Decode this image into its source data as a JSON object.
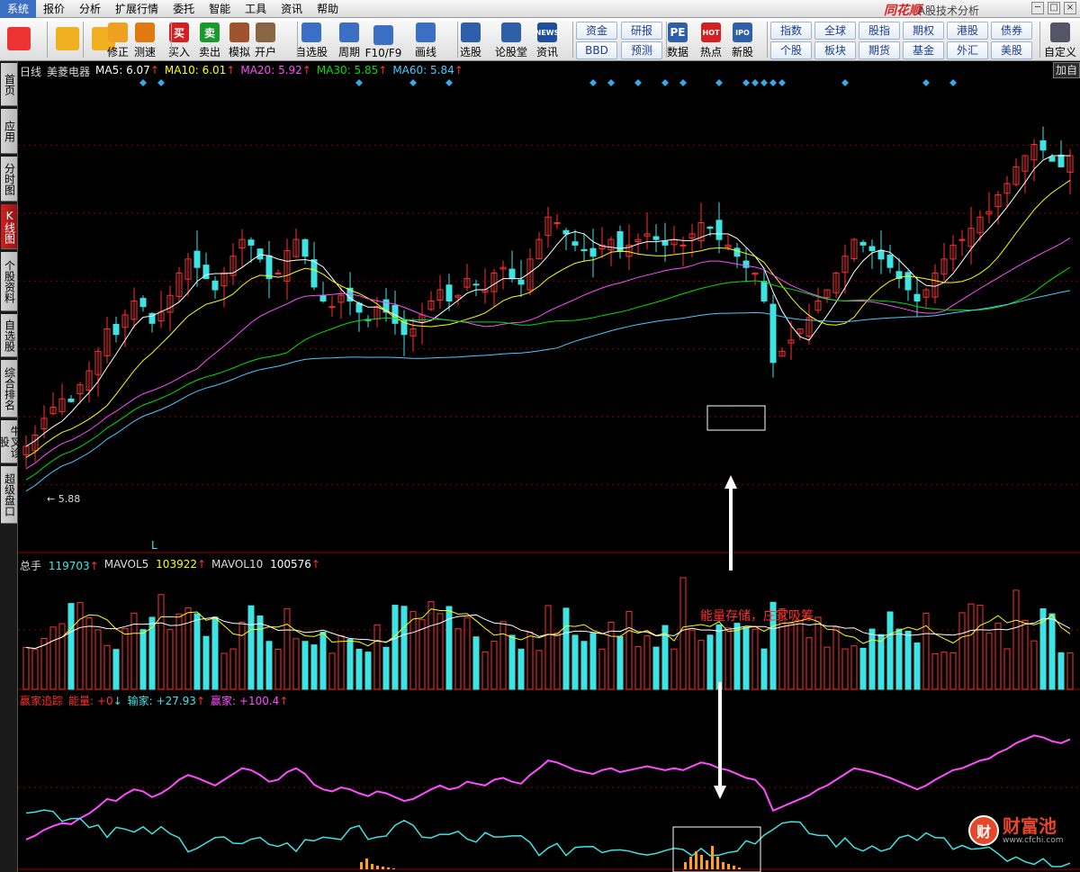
{
  "menu": {
    "items": [
      "系统",
      "报价",
      "分析",
      "扩展行情",
      "委托",
      "智能",
      "工具",
      "资讯",
      "帮助"
    ]
  },
  "brand": {
    "name": "同花顺",
    "subtitle": "A股技术分析"
  },
  "window_controls": [
    "─",
    "□",
    "×"
  ],
  "toolbar": {
    "buttons": [
      {
        "label": "修正",
        "icon": "refresh-icon"
      },
      {
        "label": "测速",
        "icon": "speed-test-icon"
      },
      {
        "label": "买入",
        "icon": "buy-icon",
        "glyph": "买"
      },
      {
        "label": "卖出",
        "icon": "sell-icon",
        "glyph": "卖"
      },
      {
        "label": "模拟",
        "icon": "gavel-icon"
      },
      {
        "label": "开户",
        "icon": "lock-icon"
      },
      {
        "label": "自选股",
        "icon": "star-icon"
      },
      {
        "label": "周期",
        "icon": "clock-icon"
      },
      {
        "label": "F10/F9",
        "icon": "f10-icon"
      },
      {
        "label": "画线",
        "icon": "pencil-icon"
      },
      {
        "label": "选股",
        "icon": "monitor-icon"
      },
      {
        "label": "论股堂",
        "icon": "forum-icon"
      },
      {
        "label": "资讯",
        "icon": "news-icon",
        "glyph": "NEWS"
      },
      {
        "label": "数据",
        "icon": "pe-icon",
        "glyph": "PE"
      },
      {
        "label": "热点",
        "icon": "hot-icon",
        "glyph": "HOT"
      },
      {
        "label": "新股",
        "icon": "ipo-icon",
        "glyph": "IPO"
      }
    ],
    "small_buttons_a": [
      "资金",
      "研报",
      "BBD",
      "预测"
    ],
    "small_buttons_b": [
      "指数",
      "全球",
      "股指",
      "期权",
      "港股",
      "债券",
      "个股",
      "板块",
      "期货",
      "基金",
      "外汇",
      "美股"
    ],
    "custom_label": "自定义"
  },
  "sidebar": {
    "tabs": [
      {
        "label": "首页",
        "active": false
      },
      {
        "label": "应用",
        "active": false
      },
      {
        "label": "分时图",
        "active": false
      },
      {
        "label": "K线图",
        "active": true
      },
      {
        "label": "个股资料",
        "active": false
      },
      {
        "label": "自选股",
        "active": false
      },
      {
        "label": "综合排名",
        "active": false
      },
      {
        "label": "牛叉诊股",
        "active": false
      },
      {
        "label": "超级盘口",
        "active": false
      }
    ]
  },
  "price_panel": {
    "period": "日线",
    "stock": "美菱电器",
    "ma": [
      {
        "name": "MA5",
        "value": "6.07",
        "color": "#ffffff"
      },
      {
        "name": "MA10",
        "value": "6.01",
        "color": "#ffff00"
      },
      {
        "name": "MA20",
        "value": "5.92",
        "color": "#ff4dff"
      },
      {
        "name": "MA30",
        "value": "5.85",
        "color": "#00e000"
      },
      {
        "name": "MA60",
        "value": "5.84",
        "color": "#4dc9ff"
      }
    ],
    "add_button": "加自",
    "min_price_label": "5.88",
    "marker": "L"
  },
  "volume_panel": {
    "items": [
      {
        "name": "总手",
        "value": "119703",
        "color": "#3ee4e4"
      },
      {
        "name": "MAVOL5",
        "value": "103922",
        "color": "#ffff00"
      },
      {
        "name": "MAVOL10",
        "value": "100576",
        "color": "#ffffff"
      }
    ]
  },
  "indicator_panel": {
    "title": "赢家追踪",
    "items": [
      {
        "name": "能量",
        "value": "+0",
        "color": "#ff3030",
        "dir": "down"
      },
      {
        "name": "输家",
        "value": "+27.93",
        "color": "#3ee4e4",
        "dir": "up"
      },
      {
        "name": "赢家",
        "value": "+100.4",
        "color": "#ff4dff",
        "dir": "up"
      }
    ]
  },
  "annotation": "能量存储，庄家吸筹",
  "watermark": {
    "name": "财富池",
    "url": "www.cfchi.com"
  },
  "colors": {
    "up": "#ff3030",
    "down": "#3ee4e4",
    "grid": "#8b0000",
    "frame": "#a00000"
  },
  "chart_data": {
    "type": "candlestick",
    "price_ylim": [
      5.5,
      7.2
    ],
    "price_closes": [
      5.88,
      5.92,
      5.98,
      6.02,
      6.05,
      6.04,
      6.1,
      6.15,
      6.22,
      6.3,
      6.28,
      6.35,
      6.4,
      6.38,
      6.32,
      6.36,
      6.42,
      6.5,
      6.55,
      6.52,
      6.48,
      6.44,
      6.5,
      6.56,
      6.62,
      6.6,
      6.55,
      6.48,
      6.5,
      6.58,
      6.62,
      6.56,
      6.45,
      6.4,
      6.38,
      6.42,
      6.4,
      6.36,
      6.33,
      6.38,
      6.36,
      6.32,
      6.28,
      6.3,
      6.35,
      6.4,
      6.44,
      6.4,
      6.42,
      6.48,
      6.46,
      6.44,
      6.5,
      6.52,
      6.48,
      6.46,
      6.55,
      6.62,
      6.7,
      6.68,
      6.64,
      6.6,
      6.58,
      6.56,
      6.6,
      6.62,
      6.58,
      6.6,
      6.62,
      6.64,
      6.62,
      6.6,
      6.62,
      6.6,
      6.64,
      6.68,
      6.66,
      6.62,
      6.6,
      6.56,
      6.52,
      6.5,
      6.4,
      6.18,
      6.22,
      6.26,
      6.3,
      6.34,
      6.4,
      6.44,
      6.5,
      6.56,
      6.62,
      6.6,
      6.58,
      6.55,
      6.52,
      6.48,
      6.44,
      6.4,
      6.44,
      6.5,
      6.55,
      6.6,
      6.62,
      6.66,
      6.7,
      6.72,
      6.78,
      6.82,
      6.88,
      6.92,
      6.96,
      6.94,
      6.9,
      6.88,
      6.92
    ],
    "volume_ylim": [
      0,
      200000
    ],
    "indicator_ylim": [
      0,
      120
    ]
  }
}
